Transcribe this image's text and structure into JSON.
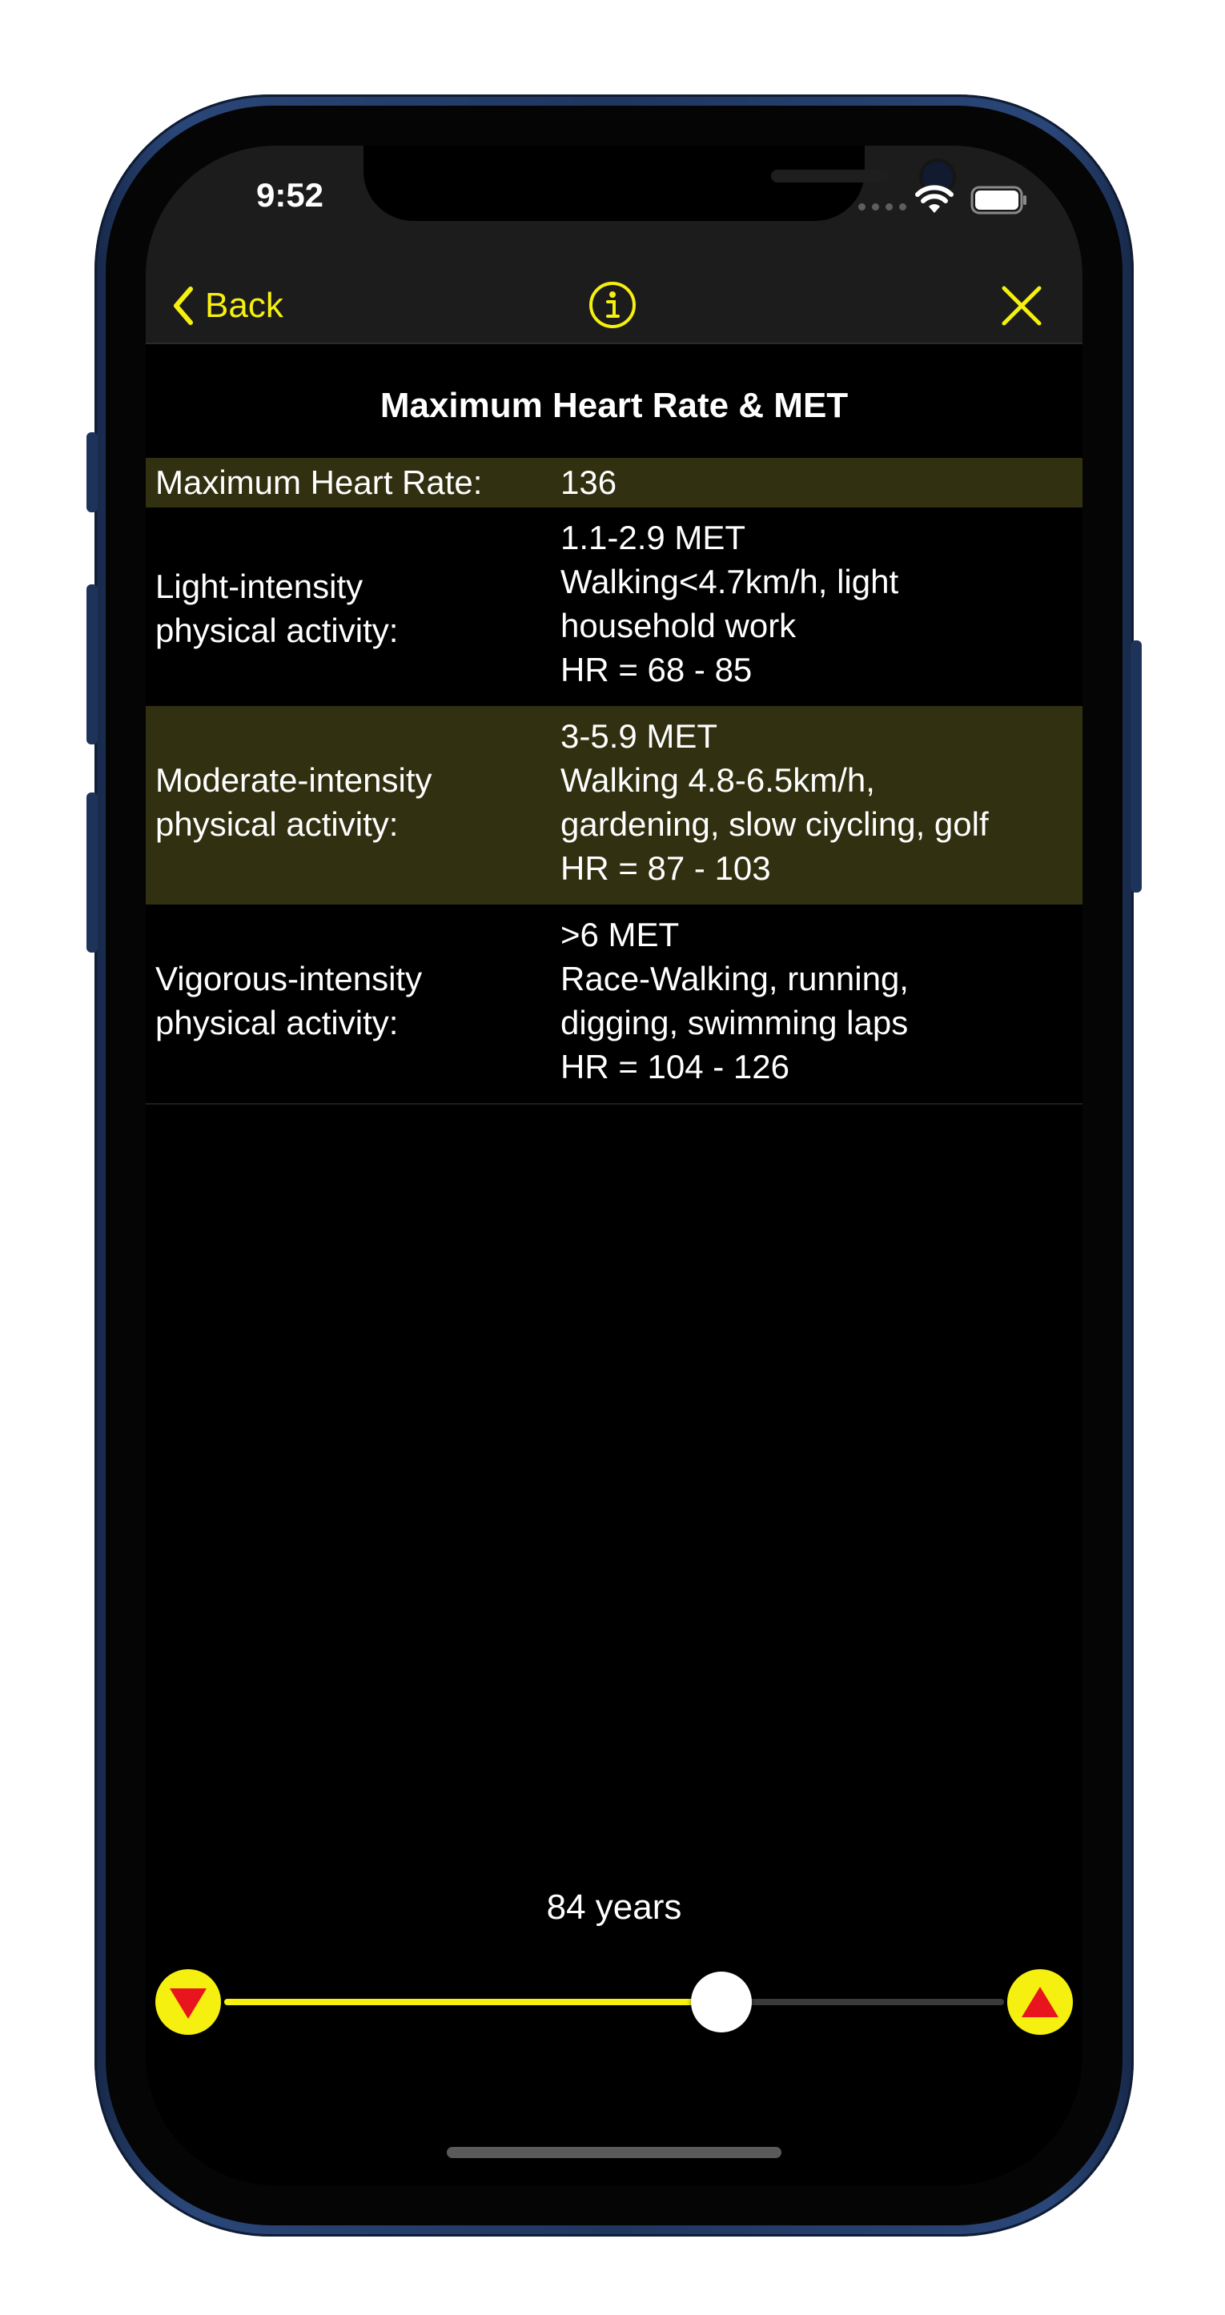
{
  "status_bar": {
    "time": "9:52"
  },
  "nav": {
    "back_label": "Back"
  },
  "page": {
    "title": "Maximum Heart Rate & MET"
  },
  "table": {
    "max_hr": {
      "label": "Maximum Heart Rate:",
      "value": "136"
    },
    "light": {
      "label_lines": [
        "Light-intensity",
        "physical activity:"
      ],
      "value_lines": [
        "1.1-2.9 MET",
        "Walking<4.7km/h, light",
        "household work",
        "HR = 68 - 85"
      ]
    },
    "moderate": {
      "label_lines": [
        "Moderate-intensity",
        "physical activity:"
      ],
      "value_lines": [
        "3-5.9 MET",
        "Walking 4.8-6.5km/h,",
        "gardening, slow ciycling, golf",
        "HR = 87 - 103"
      ]
    },
    "vigorous": {
      "label_lines": [
        ">6 MET",
        "Race-Walking, running,",
        "digging, swimming laps",
        "HR = 104 - 126"
      ],
      "label_title_lines": [
        "Vigorous-intensity",
        "physical activity:"
      ]
    }
  },
  "age": {
    "label": "84 years"
  },
  "slider": {
    "fraction": 0.638
  },
  "colors": {
    "accent": "#f5f010",
    "row_highlight": "#313010",
    "background": "#000000",
    "decrement_arrow": "#e8141e",
    "increment_arrow": "#e8141e"
  },
  "icons": {
    "back": "chevron-left-icon",
    "info": "info-circle-icon",
    "close": "close-icon",
    "decrement": "triangle-down-icon",
    "increment": "triangle-up-icon"
  }
}
